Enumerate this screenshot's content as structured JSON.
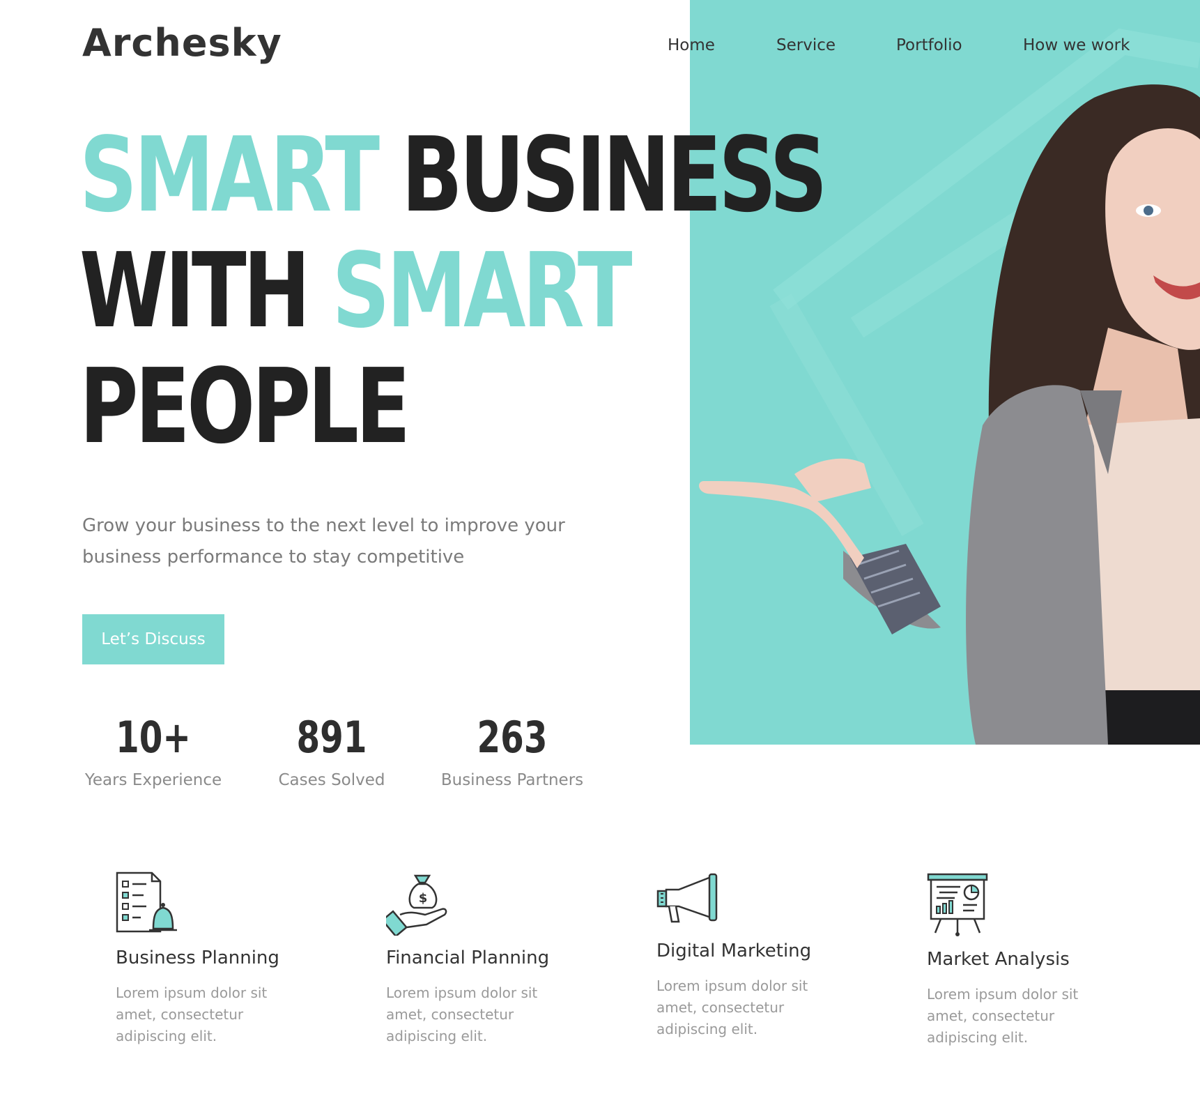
{
  "brand": {
    "logo_text": "Archesky"
  },
  "nav": {
    "items": [
      "Home",
      "Service",
      "Portfolio",
      "How we work"
    ]
  },
  "hero": {
    "headline": {
      "line1_accent": "SMART",
      "line1_dark": "BUSINESS",
      "line2_dark": "WITH",
      "line2_accent": "SMART",
      "line3_dark": "PEOPLE"
    },
    "subtitle_line1": "Grow your business to the next level to improve your",
    "subtitle_line2": "business performance to stay competitive",
    "cta_label": "Let’s Discuss",
    "image_alt": "smiling-businesswoman"
  },
  "stats": [
    {
      "value": "10+",
      "label": "Years Experience"
    },
    {
      "value": "891",
      "label": "Cases Solved"
    },
    {
      "value": "263",
      "label": "Business Partners"
    }
  ],
  "services": [
    {
      "title": "Business Planning",
      "description": "Lorem ipsum dolor sit amet, consectetur adipiscing elit.",
      "icon": "checklist-bell-icon"
    },
    {
      "title": "Financial Planning",
      "description": "Lorem ipsum dolor sit amet, consectetur adipiscing elit.",
      "icon": "money-bag-hand-icon"
    },
    {
      "title": "Digital Marketing",
      "description": "Lorem ipsum dolor sit amet, consectetur adipiscing elit.",
      "icon": "megaphone-icon"
    },
    {
      "title": "Market Analysis",
      "description": "Lorem ipsum dolor sit amet, consectetur adipiscing elit.",
      "icon": "presentation-board-icon"
    }
  ],
  "colors": {
    "accent": "#80d9d1",
    "text_dark": "#222222",
    "text_muted": "#8a8a8a"
  }
}
